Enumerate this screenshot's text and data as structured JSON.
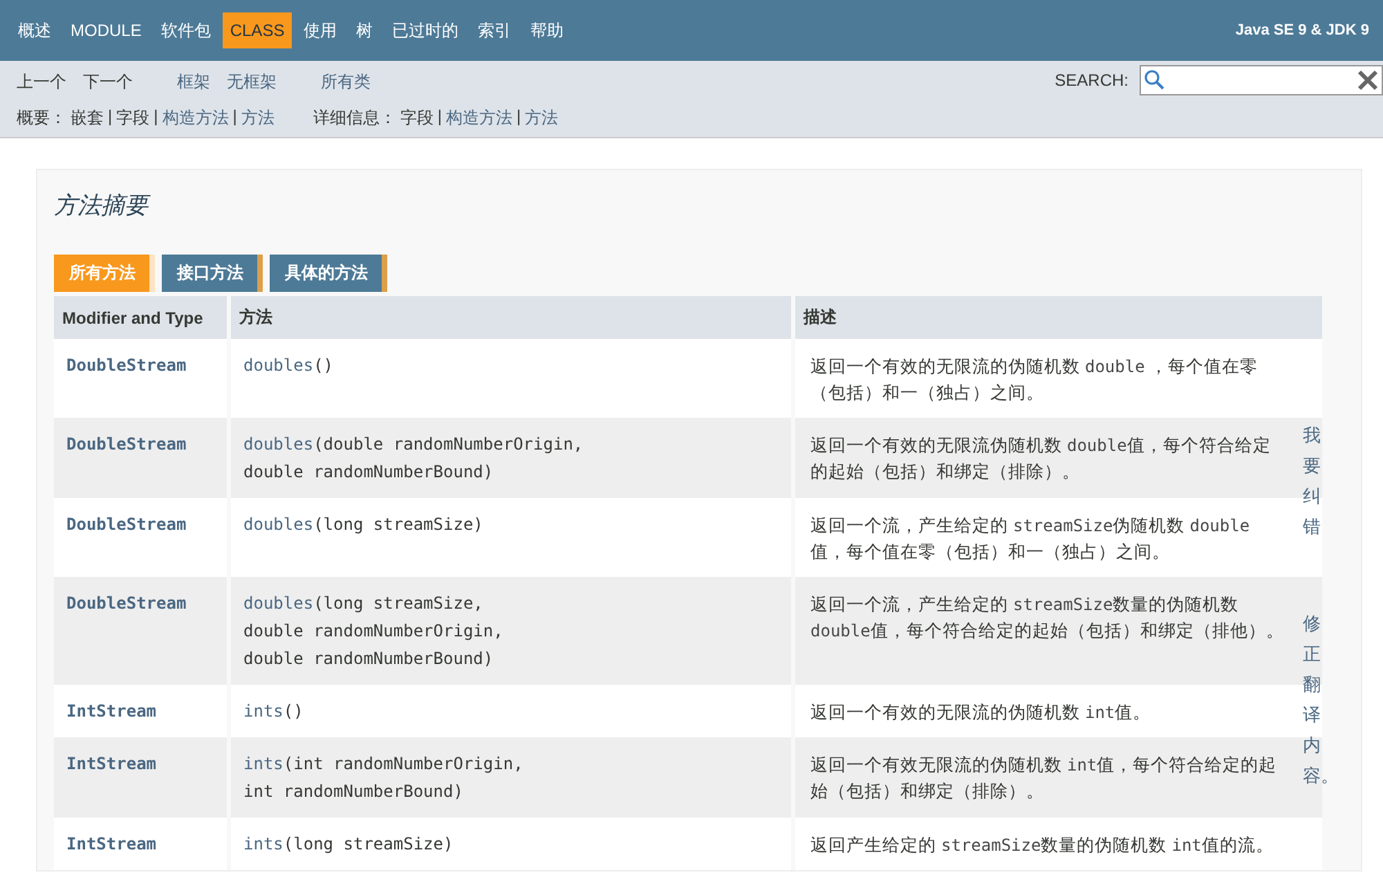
{
  "top_nav": {
    "items": [
      {
        "label": "概述",
        "selected": false
      },
      {
        "label": "MODULE",
        "selected": false
      },
      {
        "label": "软件包",
        "selected": false
      },
      {
        "label": "CLASS",
        "selected": true
      },
      {
        "label": "使用",
        "selected": false
      },
      {
        "label": "树",
        "selected": false
      },
      {
        "label": "已过时的",
        "selected": false
      },
      {
        "label": "索引",
        "selected": false
      },
      {
        "label": "帮助",
        "selected": false
      }
    ],
    "product": "Java SE 9 & JDK 9"
  },
  "sub_nav": {
    "prev_next": [
      {
        "label": "上一个",
        "kind": "text"
      },
      {
        "label": "下一个",
        "kind": "text"
      }
    ],
    "frames": [
      {
        "label": "框架",
        "kind": "link"
      },
      {
        "label": "无框架",
        "kind": "link"
      }
    ],
    "all_classes": {
      "label": "所有类",
      "kind": "link"
    },
    "search": {
      "label": "SEARCH:"
    },
    "summary": {
      "label": "概要：",
      "items": [
        {
          "label": "嵌套",
          "kind": "text"
        },
        {
          "label": "|",
          "kind": "separator"
        },
        {
          "label": "字段",
          "kind": "text"
        },
        {
          "label": "|",
          "kind": "separator"
        },
        {
          "label": "构造方法",
          "kind": "link"
        },
        {
          "label": "|",
          "kind": "separator"
        },
        {
          "label": "方法",
          "kind": "link"
        }
      ]
    },
    "detail": {
      "label": "详细信息：",
      "items": [
        {
          "label": "字段",
          "kind": "text"
        },
        {
          "label": "|",
          "kind": "separator"
        },
        {
          "label": "构造方法",
          "kind": "link"
        },
        {
          "label": "|",
          "kind": "separator"
        },
        {
          "label": "方法",
          "kind": "link"
        }
      ]
    }
  },
  "section": {
    "title": "方法摘要",
    "tabs": [
      {
        "label": "所有方法",
        "selected": true
      },
      {
        "label": "接口方法",
        "selected": false
      },
      {
        "label": "具体的方法",
        "selected": false
      }
    ],
    "table": {
      "columns": [
        "Modifier and Type",
        "方法",
        "描述"
      ],
      "rows": [
        {
          "type": "DoubleStream",
          "name": "doubles",
          "params": [
            "()"
          ],
          "description": [
            {
              "kind": "text",
              "text": "返回一个有效的无限流的伪随机数 "
            },
            {
              "kind": "code",
              "text": "double"
            },
            {
              "kind": "text",
              "text": " ，每个值在零（包括）和一（独占）之间。"
            }
          ]
        },
        {
          "type": "DoubleStream",
          "name": "doubles",
          "params": [
            "(double randomNumberOrigin,",
            "double randomNumberBound)"
          ],
          "description": [
            {
              "kind": "text",
              "text": "返回一个有效的无限流伪随机数 "
            },
            {
              "kind": "code",
              "text": "double"
            },
            {
              "kind": "text",
              "text": "值，每个符合给定的起始（包括）和绑定（排除）。"
            }
          ]
        },
        {
          "type": "DoubleStream",
          "name": "doubles",
          "params": [
            "(long streamSize)"
          ],
          "description": [
            {
              "kind": "text",
              "text": "返回一个流，产生给定的 "
            },
            {
              "kind": "code",
              "text": "streamSize"
            },
            {
              "kind": "text",
              "text": "伪随机数 "
            },
            {
              "kind": "code",
              "text": "double"
            },
            {
              "kind": "text",
              "text": " 值，每个值在零（包括）和一（独占）之间。"
            }
          ]
        },
        {
          "type": "DoubleStream",
          "name": "doubles",
          "params": [
            "(long streamSize,",
            "double randomNumberOrigin,",
            "double randomNumberBound)"
          ],
          "description": [
            {
              "kind": "text",
              "text": "返回一个流，产生给定的 "
            },
            {
              "kind": "code",
              "text": "streamSize"
            },
            {
              "kind": "text",
              "text": "数量的伪随机数 "
            },
            {
              "kind": "code",
              "text": "double"
            },
            {
              "kind": "text",
              "text": "值，每个符合给定的起始（包括）和绑定（排他）。"
            }
          ]
        },
        {
          "type": "IntStream",
          "name": "ints",
          "params": [
            "()"
          ],
          "description": [
            {
              "kind": "text",
              "text": "返回一个有效的无限流的伪随机数 "
            },
            {
              "kind": "code",
              "text": "int"
            },
            {
              "kind": "text",
              "text": "值。"
            }
          ]
        },
        {
          "type": "IntStream",
          "name": "ints",
          "params": [
            "(int randomNumberOrigin,",
            "int randomNumberBound)"
          ],
          "description": [
            {
              "kind": "text",
              "text": "返回一个有效无限流的伪随机数 "
            },
            {
              "kind": "code",
              "text": "int"
            },
            {
              "kind": "text",
              "text": "值，每个符合给定的起始（包括）和绑定（排除）。"
            }
          ]
        },
        {
          "type": "IntStream",
          "name": "ints",
          "params": [
            "(long streamSize)"
          ],
          "description": [
            {
              "kind": "text",
              "text": "返回产生给定的 "
            },
            {
              "kind": "code",
              "text": "streamSize"
            },
            {
              "kind": "text",
              "text": "数量的伪随机数 "
            },
            {
              "kind": "code",
              "text": "int"
            },
            {
              "kind": "text",
              "text": "值的流。"
            }
          ]
        }
      ]
    }
  },
  "side_links": [
    "我要纠错",
    "修正翻译内容。"
  ]
}
